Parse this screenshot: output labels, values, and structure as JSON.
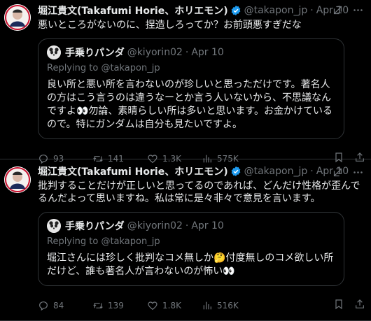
{
  "tweets": [
    {
      "author_name": "堀江貴文(Takafumi Horie、ホリエモン)",
      "author_handle": "@takapon_jp",
      "dot": "·",
      "date": "Apr 10",
      "text": "悪いところがないのに、捏造しろってか？お前頭悪すぎだな",
      "quote": {
        "author_name": "手乗りパンダ",
        "author_handle": "@kiyorin02",
        "dot": "·",
        "date": "Apr 10",
        "replying_to_prefix": "Replying to ",
        "replying_to_handle": "@takapon_jp",
        "text": "良い所と悪い所を言わないのが珍しいと思っただけです。著名人の方はこう言うのは違うなーとか言う人いないから、不思議なんですよ👀勿論、素晴らしい所は多いと思います。お金かけているので。特にガンダムは自分も見たいですよ。"
      },
      "stats": {
        "replies": "93",
        "reposts": "141",
        "likes": "1.3K",
        "views": "575K"
      }
    },
    {
      "author_name": "堀江貴文(Takafumi Horie、ホリエモン)",
      "author_handle": "@takapon_jp",
      "dot": "·",
      "date": "Apr 10",
      "text": "批判することだけが正しいと思ってるのであれば、どんだけ性格が歪んでるんだよって思いますね。私は常に是々非々で意見を言います。",
      "quote": {
        "author_name": "手乗りパンダ",
        "author_handle": "@kiyorin02",
        "dot": "·",
        "date": "Apr 10",
        "replying_to_prefix": "Replying to ",
        "replying_to_handle": "@takapon_jp",
        "text": "堀江さんには珍しく批判なコメ無しか🤔付度無しのコメ欲しい所だけど、誰も著名人が言わないのが怖い👀"
      },
      "stats": {
        "replies": "84",
        "reposts": "139",
        "likes": "1.8K",
        "views": "516K"
      }
    }
  ],
  "icons": {
    "verified": "verified-badge-icon",
    "grok": "grok-icon",
    "more": "more-icon",
    "reply": "reply-icon",
    "repost": "repost-icon",
    "like": "like-icon",
    "views": "views-icon",
    "bookmark": "bookmark-icon",
    "share": "share-icon"
  },
  "colors": {
    "background": "#000000",
    "text": "#e7e9ea",
    "muted": "#71767b",
    "border": "#2f3336",
    "verified": "#1d9bf0"
  }
}
